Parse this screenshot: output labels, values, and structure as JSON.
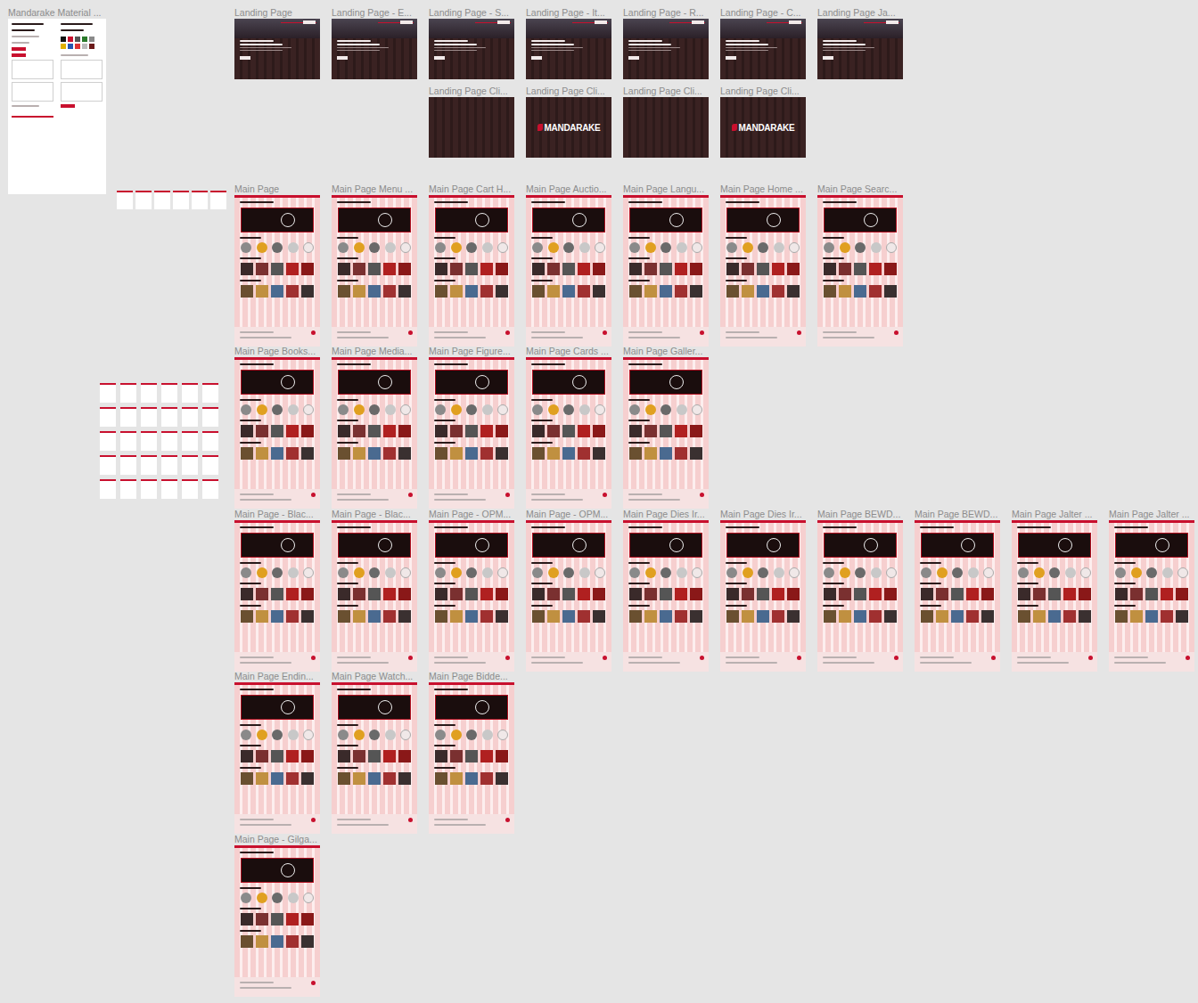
{
  "canvas": {
    "brand": "MANDARAKE",
    "styleguide": {
      "label": "Mandarake Material ..."
    },
    "sections": [
      {
        "frames": [
          {
            "label": "Landing Page",
            "kind": "landing"
          },
          {
            "label": "Landing Page - E...",
            "kind": "landing"
          },
          {
            "label": "Landing Page - S...",
            "kind": "landing"
          },
          {
            "label": "Landing Page - It...",
            "kind": "landing"
          },
          {
            "label": "Landing Page - R...",
            "kind": "landing"
          },
          {
            "label": "Landing Page - C...",
            "kind": "landing"
          },
          {
            "label": "Landing Page Ja...",
            "kind": "landing"
          }
        ]
      },
      {
        "frames": [
          {
            "label": "Landing Page Cli...",
            "kind": "splash-blank"
          },
          {
            "label": "Landing Page Cli...",
            "kind": "splash-logo"
          },
          {
            "label": "Landing Page Cli...",
            "kind": "splash-blank"
          },
          {
            "label": "Landing Page Cli...",
            "kind": "splash-logo"
          }
        ]
      },
      {
        "frames": [
          {
            "label": "Main Page",
            "kind": "main"
          },
          {
            "label": "Main Page Menu ...",
            "kind": "main"
          },
          {
            "label": "Main Page Cart H...",
            "kind": "main"
          },
          {
            "label": "Main Page Auctio...",
            "kind": "main"
          },
          {
            "label": "Main Page Langu...",
            "kind": "main"
          },
          {
            "label": "Main Page Home ...",
            "kind": "main"
          },
          {
            "label": "Main Page Searc...",
            "kind": "main"
          }
        ]
      },
      {
        "frames": [
          {
            "label": "Main Page Books...",
            "kind": "main"
          },
          {
            "label": "Main Page Media...",
            "kind": "main"
          },
          {
            "label": "Main Page Figure...",
            "kind": "main"
          },
          {
            "label": "Main Page Cards ...",
            "kind": "main"
          },
          {
            "label": "Main Page Galler...",
            "kind": "main"
          }
        ]
      },
      {
        "frames": [
          {
            "label": "Main Page - Blac...",
            "kind": "main"
          },
          {
            "label": "Main Page - Blac...",
            "kind": "main"
          },
          {
            "label": "Main Page - OPM...",
            "kind": "main"
          },
          {
            "label": "Main Page - OPM...",
            "kind": "main"
          },
          {
            "label": "Main Page Dies Ir...",
            "kind": "main"
          },
          {
            "label": "Main Page Dies Ir...",
            "kind": "main"
          },
          {
            "label": "Main Page BEWD...",
            "kind": "main"
          },
          {
            "label": "Main Page BEWD...",
            "kind": "main"
          },
          {
            "label": "Main Page Jalter ...",
            "kind": "main"
          },
          {
            "label": "Main Page Jalter ...",
            "kind": "main"
          }
        ]
      },
      {
        "frames": [
          {
            "label": "Main Page Endin...",
            "kind": "main"
          },
          {
            "label": "Main Page Watch...",
            "kind": "main"
          },
          {
            "label": "Main Page Bidde...",
            "kind": "main"
          }
        ]
      },
      {
        "frames": [
          {
            "label": "Main Page - Gilga...",
            "kind": "main"
          }
        ]
      }
    ]
  }
}
